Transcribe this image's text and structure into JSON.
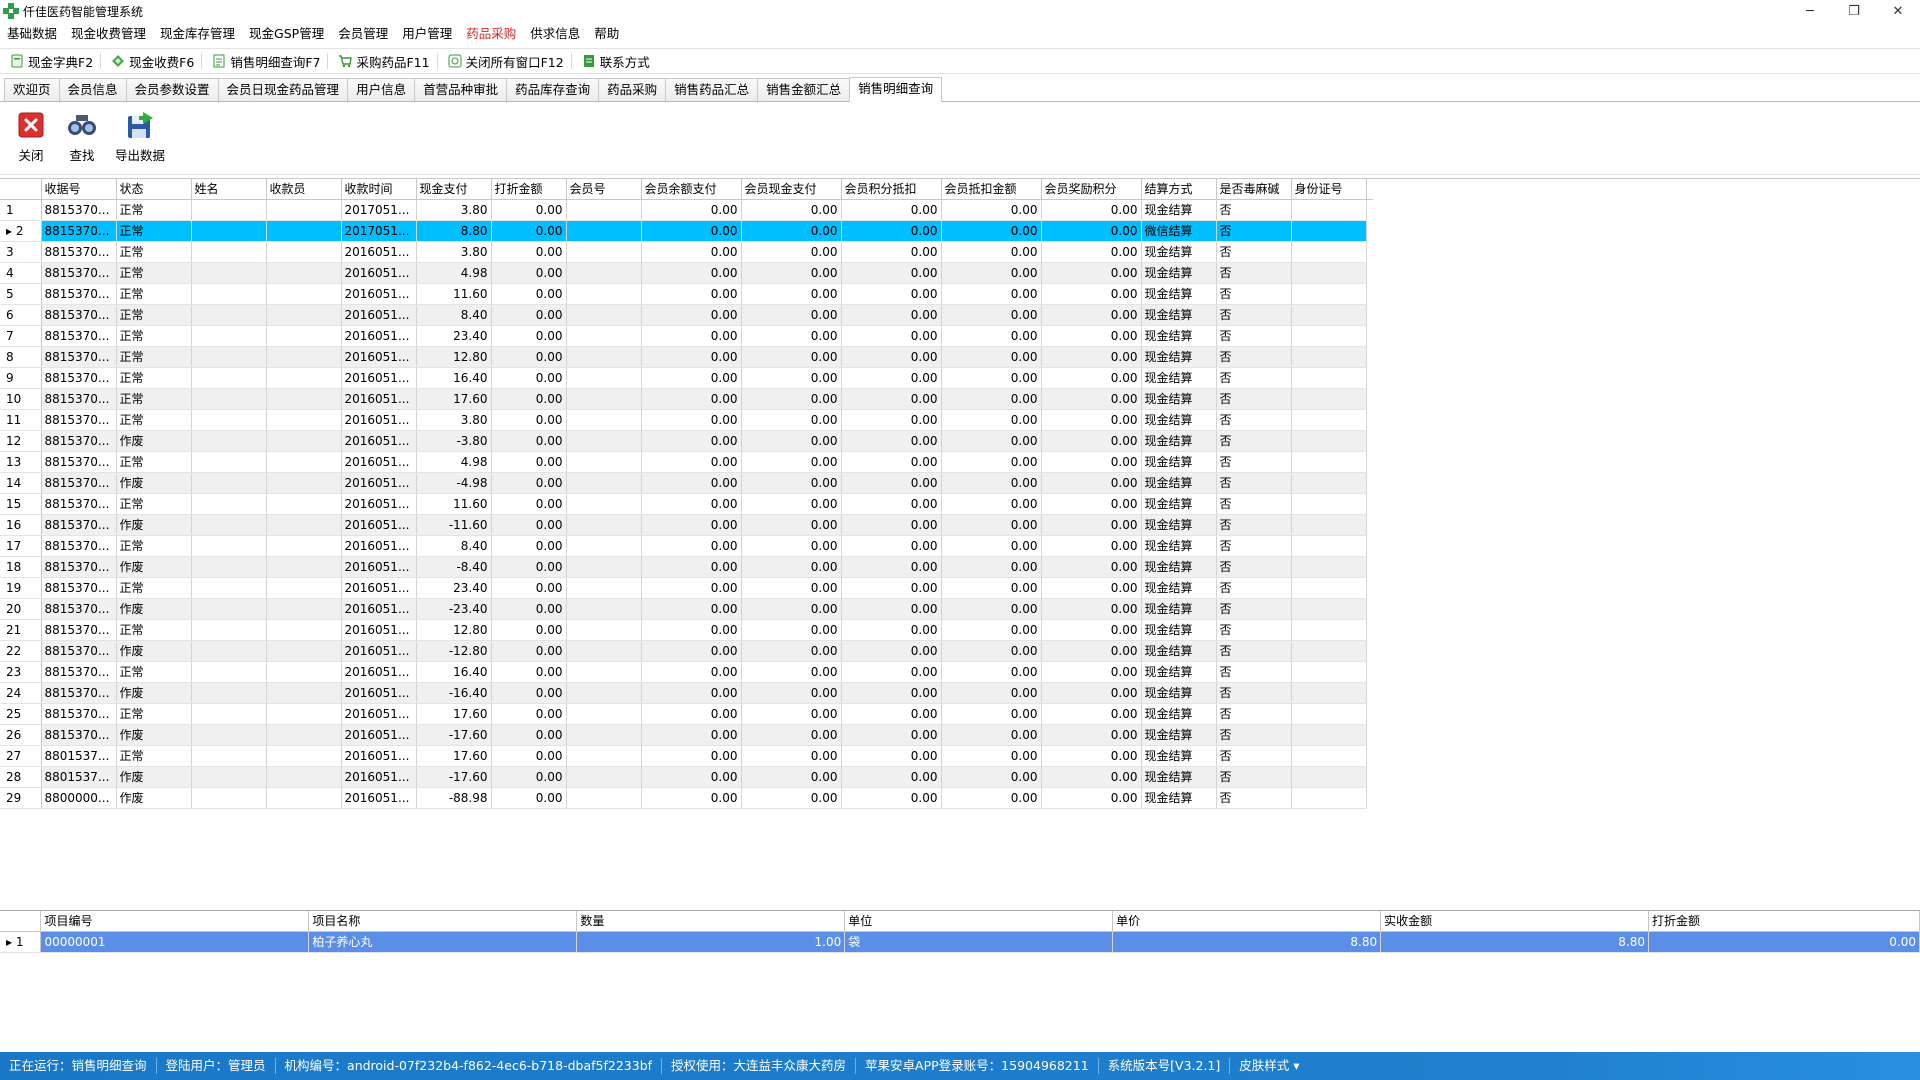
{
  "window": {
    "title": "仟佳医药智能管理系统",
    "minimize": "─",
    "restore": "❐",
    "close": "✕"
  },
  "menu": [
    "基础数据",
    "现金收费管理",
    "现金库存管理",
    "现金GSP管理",
    "会员管理",
    "用户管理",
    "药品采购",
    "供求信息",
    "帮助"
  ],
  "menu_active_index": 6,
  "quickbar": [
    {
      "label": "现金字典F2",
      "icon": "book-icon",
      "color": "#3a9a3a"
    },
    {
      "label": "现金收费F6",
      "icon": "diamond-icon",
      "color": "#3a9a3a"
    },
    {
      "label": "销售明细查询F7",
      "icon": "document-icon",
      "color": "#3a9a3a"
    },
    {
      "label": "采购药品F11",
      "icon": "cart-icon",
      "color": "#3a9a3a"
    },
    {
      "label": "关闭所有窗口F12",
      "icon": "window-icon",
      "color": "#3a9a3a"
    },
    {
      "label": "联系方式",
      "icon": "phone-icon",
      "color": "#3a9a3a"
    }
  ],
  "tabs": [
    "欢迎页",
    "会员信息",
    "会员参数设置",
    "会员日现金药品管理",
    "用户信息",
    "首营品种审批",
    "药品库存查询",
    "药品采购",
    "销售药品汇总",
    "销售金额汇总",
    "销售明细查询"
  ],
  "active_tab_index": 10,
  "toolbar": {
    "close_label": "关闭",
    "search_label": "查找",
    "export_label": "导出数据"
  },
  "main_grid": {
    "columns": [
      "收据号",
      "状态",
      "姓名",
      "收款员",
      "收款时间",
      "现金支付",
      "打折金额",
      "会员号",
      "会员余额支付",
      "会员现金支付",
      "会员积分抵扣",
      "会员抵扣金额",
      "会员奖励积分",
      "结算方式",
      "是否毒麻碱",
      "身份证号"
    ],
    "selected_row_index": 1,
    "current_row_marker": "▸",
    "rows": [
      [
        "8815370...",
        "正常",
        "",
        "",
        "2017051...",
        "3.80",
        "0.00",
        "",
        "0.00",
        "0.00",
        "0.00",
        "0.00",
        "0.00",
        "现金结算",
        "否",
        ""
      ],
      [
        "8815370...",
        "正常",
        "",
        "",
        "2017051...",
        "8.80",
        "0.00",
        "",
        "0.00",
        "0.00",
        "0.00",
        "0.00",
        "0.00",
        "微信结算",
        "否",
        ""
      ],
      [
        "8815370...",
        "正常",
        "",
        "",
        "2016051...",
        "3.80",
        "0.00",
        "",
        "0.00",
        "0.00",
        "0.00",
        "0.00",
        "0.00",
        "现金结算",
        "否",
        ""
      ],
      [
        "8815370...",
        "正常",
        "",
        "",
        "2016051...",
        "4.98",
        "0.00",
        "",
        "0.00",
        "0.00",
        "0.00",
        "0.00",
        "0.00",
        "现金结算",
        "否",
        ""
      ],
      [
        "8815370...",
        "正常",
        "",
        "",
        "2016051...",
        "11.60",
        "0.00",
        "",
        "0.00",
        "0.00",
        "0.00",
        "0.00",
        "0.00",
        "现金结算",
        "否",
        ""
      ],
      [
        "8815370...",
        "正常",
        "",
        "",
        "2016051...",
        "8.40",
        "0.00",
        "",
        "0.00",
        "0.00",
        "0.00",
        "0.00",
        "0.00",
        "现金结算",
        "否",
        ""
      ],
      [
        "8815370...",
        "正常",
        "",
        "",
        "2016051...",
        "23.40",
        "0.00",
        "",
        "0.00",
        "0.00",
        "0.00",
        "0.00",
        "0.00",
        "现金结算",
        "否",
        ""
      ],
      [
        "8815370...",
        "正常",
        "",
        "",
        "2016051...",
        "12.80",
        "0.00",
        "",
        "0.00",
        "0.00",
        "0.00",
        "0.00",
        "0.00",
        "现金结算",
        "否",
        ""
      ],
      [
        "8815370...",
        "正常",
        "",
        "",
        "2016051...",
        "16.40",
        "0.00",
        "",
        "0.00",
        "0.00",
        "0.00",
        "0.00",
        "0.00",
        "现金结算",
        "否",
        ""
      ],
      [
        "8815370...",
        "正常",
        "",
        "",
        "2016051...",
        "17.60",
        "0.00",
        "",
        "0.00",
        "0.00",
        "0.00",
        "0.00",
        "0.00",
        "现金结算",
        "否",
        ""
      ],
      [
        "8815370...",
        "正常",
        "",
        "",
        "2016051...",
        "3.80",
        "0.00",
        "",
        "0.00",
        "0.00",
        "0.00",
        "0.00",
        "0.00",
        "现金结算",
        "否",
        ""
      ],
      [
        "8815370...",
        "作废",
        "",
        "",
        "2016051...",
        "-3.80",
        "0.00",
        "",
        "0.00",
        "0.00",
        "0.00",
        "0.00",
        "0.00",
        "现金结算",
        "否",
        ""
      ],
      [
        "8815370...",
        "正常",
        "",
        "",
        "2016051...",
        "4.98",
        "0.00",
        "",
        "0.00",
        "0.00",
        "0.00",
        "0.00",
        "0.00",
        "现金结算",
        "否",
        ""
      ],
      [
        "8815370...",
        "作废",
        "",
        "",
        "2016051...",
        "-4.98",
        "0.00",
        "",
        "0.00",
        "0.00",
        "0.00",
        "0.00",
        "0.00",
        "现金结算",
        "否",
        ""
      ],
      [
        "8815370...",
        "正常",
        "",
        "",
        "2016051...",
        "11.60",
        "0.00",
        "",
        "0.00",
        "0.00",
        "0.00",
        "0.00",
        "0.00",
        "现金结算",
        "否",
        ""
      ],
      [
        "8815370...",
        "作废",
        "",
        "",
        "2016051...",
        "-11.60",
        "0.00",
        "",
        "0.00",
        "0.00",
        "0.00",
        "0.00",
        "0.00",
        "现金结算",
        "否",
        ""
      ],
      [
        "8815370...",
        "正常",
        "",
        "",
        "2016051...",
        "8.40",
        "0.00",
        "",
        "0.00",
        "0.00",
        "0.00",
        "0.00",
        "0.00",
        "现金结算",
        "否",
        ""
      ],
      [
        "8815370...",
        "作废",
        "",
        "",
        "2016051...",
        "-8.40",
        "0.00",
        "",
        "0.00",
        "0.00",
        "0.00",
        "0.00",
        "0.00",
        "现金结算",
        "否",
        ""
      ],
      [
        "8815370...",
        "正常",
        "",
        "",
        "2016051...",
        "23.40",
        "0.00",
        "",
        "0.00",
        "0.00",
        "0.00",
        "0.00",
        "0.00",
        "现金结算",
        "否",
        ""
      ],
      [
        "8815370...",
        "作废",
        "",
        "",
        "2016051...",
        "-23.40",
        "0.00",
        "",
        "0.00",
        "0.00",
        "0.00",
        "0.00",
        "0.00",
        "现金结算",
        "否",
        ""
      ],
      [
        "8815370...",
        "正常",
        "",
        "",
        "2016051...",
        "12.80",
        "0.00",
        "",
        "0.00",
        "0.00",
        "0.00",
        "0.00",
        "0.00",
        "现金结算",
        "否",
        ""
      ],
      [
        "8815370...",
        "作废",
        "",
        "",
        "2016051...",
        "-12.80",
        "0.00",
        "",
        "0.00",
        "0.00",
        "0.00",
        "0.00",
        "0.00",
        "现金结算",
        "否",
        ""
      ],
      [
        "8815370...",
        "正常",
        "",
        "",
        "2016051...",
        "16.40",
        "0.00",
        "",
        "0.00",
        "0.00",
        "0.00",
        "0.00",
        "0.00",
        "现金结算",
        "否",
        ""
      ],
      [
        "8815370...",
        "作废",
        "",
        "",
        "2016051...",
        "-16.40",
        "0.00",
        "",
        "0.00",
        "0.00",
        "0.00",
        "0.00",
        "0.00",
        "现金结算",
        "否",
        ""
      ],
      [
        "8815370...",
        "正常",
        "",
        "",
        "2016051...",
        "17.60",
        "0.00",
        "",
        "0.00",
        "0.00",
        "0.00",
        "0.00",
        "0.00",
        "现金结算",
        "否",
        ""
      ],
      [
        "8815370...",
        "作废",
        "",
        "",
        "2016051...",
        "-17.60",
        "0.00",
        "",
        "0.00",
        "0.00",
        "0.00",
        "0.00",
        "0.00",
        "现金结算",
        "否",
        ""
      ],
      [
        "8801537...",
        "正常",
        "",
        "",
        "2016051...",
        "17.60",
        "0.00",
        "",
        "0.00",
        "0.00",
        "0.00",
        "0.00",
        "0.00",
        "现金结算",
        "否",
        ""
      ],
      [
        "8801537...",
        "作废",
        "",
        "",
        "2016051...",
        "-17.60",
        "0.00",
        "",
        "0.00",
        "0.00",
        "0.00",
        "0.00",
        "0.00",
        "现金结算",
        "否",
        ""
      ],
      [
        "8800000...",
        "作废",
        "",
        "",
        "2016051...",
        "-88.98",
        "0.00",
        "",
        "0.00",
        "0.00",
        "0.00",
        "0.00",
        "0.00",
        "现金结算",
        "否",
        ""
      ]
    ]
  },
  "detail_grid": {
    "columns": [
      "项目编号",
      "项目名称",
      "数量",
      "单位",
      "单价",
      "实收金额",
      "打折金额"
    ],
    "rows": [
      [
        "00000001",
        "柏子养心丸",
        "1.00",
        "袋",
        "8.80",
        "8.80",
        "0.00"
      ]
    ]
  },
  "statusbar": [
    "正在运行：销售明细查询",
    "登陆用户：管理员",
    "机构编号：android-07f232b4-f862-4ec6-b718-dbaf5f2233bf",
    "授权使用：大连益丰众康大药房",
    "苹果安卓APP登录账号：15904968211",
    "系统版本号[V3.2.1]",
    "皮肤样式 ▾"
  ],
  "colors": {
    "selected_row": "#00bfff",
    "detail_selected_row": "#5b8ee6",
    "statusbar": "#1a78c8",
    "active_menu": "#d62828"
  }
}
